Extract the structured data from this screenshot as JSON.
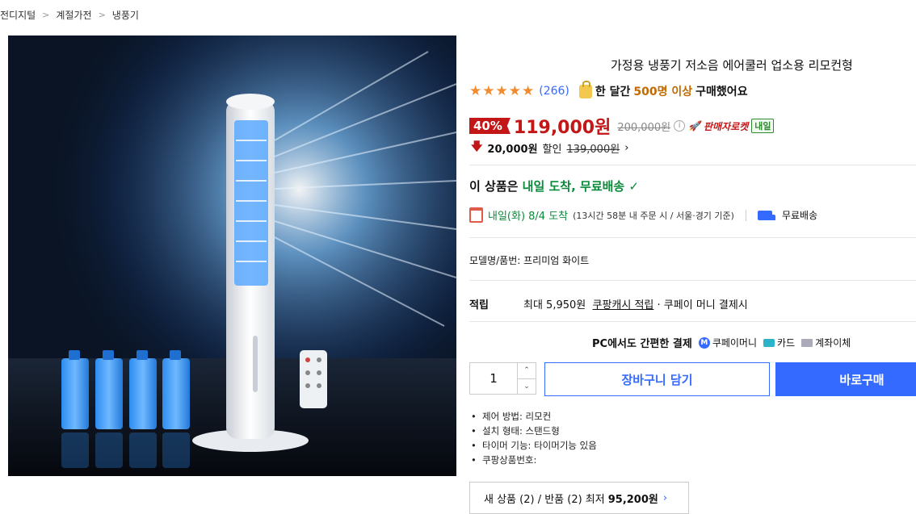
{
  "breadcrumb": [
    "전디지털",
    "계절가전",
    "냉풍기"
  ],
  "product": {
    "title": "가정용 냉풍기 저소음 에어쿨러 업소용 리모컨형",
    "rating_stars": 5,
    "review_count": "(266)",
    "monthly_buyers_prefix": "한 달간",
    "monthly_buyers_highlight": "500명 이상",
    "monthly_buyers_suffix": "구매했어요",
    "discount_rate": "40%",
    "sale_price": "119,000원",
    "original_price": "200,000원",
    "seller_rocket": "판매자로켓",
    "tomorrow_badge": "내일",
    "coupon_amount": "20,000원",
    "coupon_label": "할인",
    "coupon_base_price": "139,000원",
    "coupon_arrow": "›"
  },
  "shipping": {
    "arrival_prefix": "이 상품은",
    "arrival_highlight": "내일 도착, 무료배송",
    "arrival_check": "✓",
    "delivery_date": "내일(화) 8/4 도착",
    "delivery_note": "(13시간 58분 내 주문 시 / 서울·경기 기준)",
    "free_shipping": "무료배송"
  },
  "model": {
    "label": "모델명/품번:",
    "value": "프리미엄 화이트"
  },
  "points": {
    "label": "적립",
    "prefix": "최대 5,950원",
    "cash_link": "쿠팡캐시 적립",
    "suffix": "· 쿠페이 머니 결제시"
  },
  "payment": {
    "title": "PC에서도 간편한 결제",
    "coupay_icon_text": "M",
    "coupay": "쿠페이머니",
    "card": "카드",
    "bank": "계좌이체"
  },
  "purchase": {
    "quantity": "1",
    "up_symbol": "⌃",
    "down_symbol": "⌄",
    "cart_label": "장바구니 담기",
    "buy_label": "바로구매"
  },
  "specs": [
    "제어 방법: 리모컨",
    "설치 형태: 스탠드형",
    "타이머 기능: 타이머기능 있음",
    "쿠팡상품번호:"
  ],
  "other_sellers": {
    "text": "새 상품 (2) / 반품 (2) 최저",
    "price": "95,200원",
    "arrow": "›"
  },
  "colors": {
    "accent": "#346aff",
    "sale_red": "#c31616",
    "green": "#0a8a3a",
    "star": "#f28b2e"
  },
  "icons": [
    "chevron-right-icon",
    "star-icon",
    "shopping-bag-icon",
    "info-icon",
    "rocket-icon",
    "arrow-down-icon",
    "check-icon",
    "calendar-icon",
    "truck-icon",
    "coupay-icon",
    "card-icon",
    "bank-icon"
  ]
}
